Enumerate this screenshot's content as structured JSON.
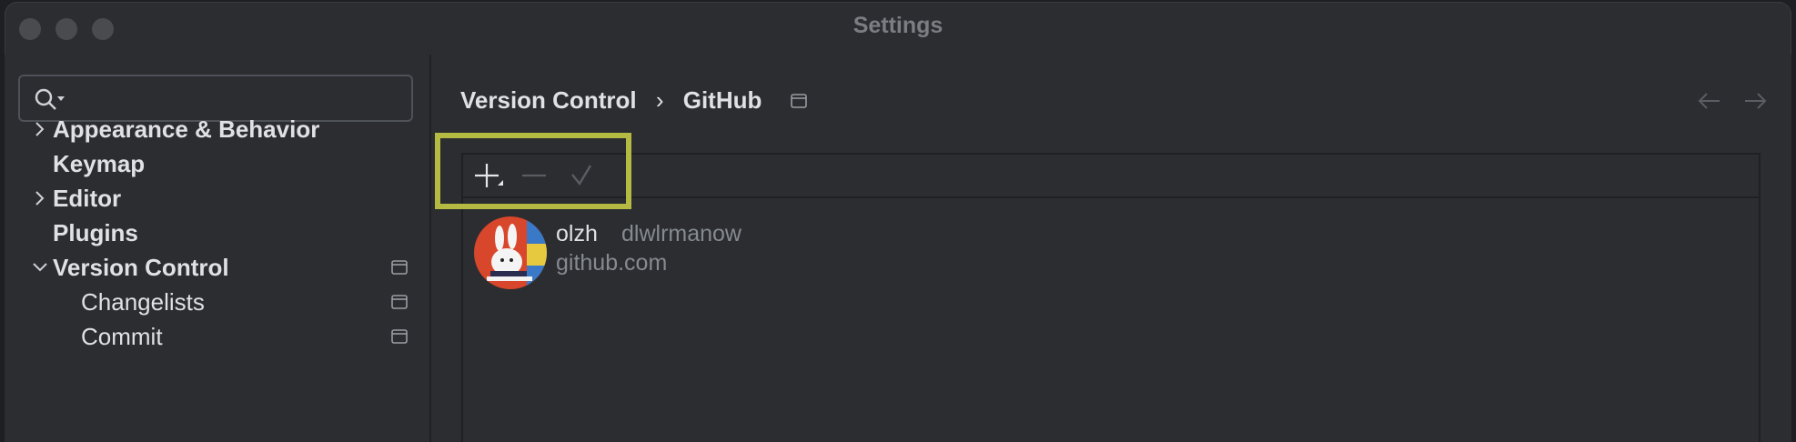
{
  "window": {
    "title": "Settings"
  },
  "search": {
    "placeholder": ""
  },
  "sidebar": {
    "items": [
      {
        "label": "Appearance & Behavior",
        "chevron": "right",
        "repo_icon": false
      },
      {
        "label": "Keymap",
        "chevron": "none",
        "repo_icon": false
      },
      {
        "label": "Editor",
        "chevron": "right",
        "repo_icon": false
      },
      {
        "label": "Plugins",
        "chevron": "none",
        "repo_icon": false
      },
      {
        "label": "Version Control",
        "chevron": "down",
        "repo_icon": true
      },
      {
        "label": "Changelists",
        "chevron": "none",
        "repo_icon": true
      },
      {
        "label": "Commit",
        "chevron": "none",
        "repo_icon": true
      }
    ]
  },
  "breadcrumb": {
    "parent": "Version Control",
    "separator": "›",
    "current": "GitHub"
  },
  "toolbar": {
    "icons": [
      "add-icon",
      "remove-icon",
      "check-icon"
    ]
  },
  "account": {
    "name": "olzh",
    "login": "dlwlrmanow",
    "server": "github.com"
  },
  "colors": {
    "highlight": "#b4ba42",
    "background": "#2b2d30",
    "text": "#dfe1e5",
    "muted": "#868a91"
  }
}
